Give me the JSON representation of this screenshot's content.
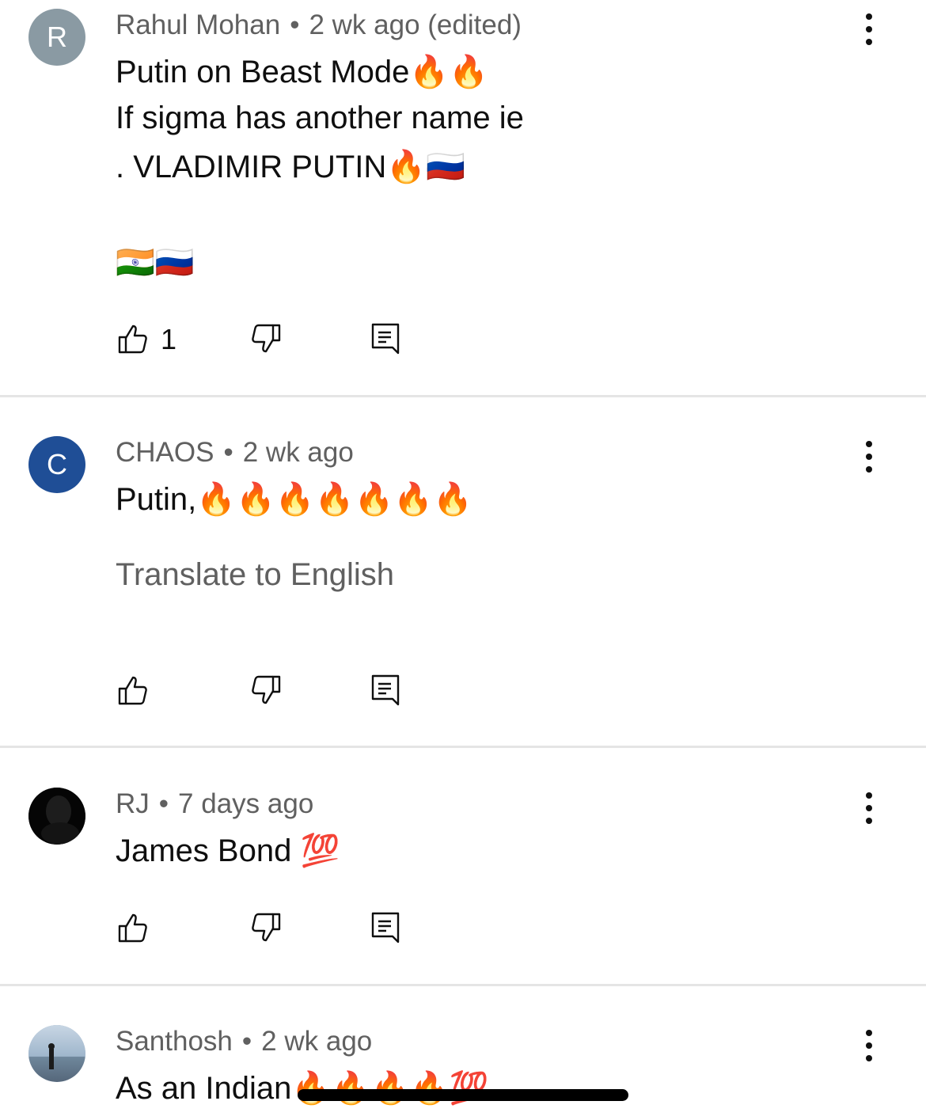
{
  "comments": [
    {
      "author": "Rahul Mohan",
      "time": "2 wk ago (edited)",
      "avatar_letter": "R",
      "avatar_color": "#8a9aa3",
      "lines": [
        "Putin on Beast Mode🔥🔥",
        "If sigma has another name ie",
        ". VLADIMIR PUTIN🔥🇷🇺",
        "🇮🇳🇷🇺"
      ],
      "likes": "1"
    },
    {
      "author": "CHAOS",
      "time": "2 wk ago",
      "avatar_letter": "C",
      "avatar_color": "#1f4e96",
      "lines": [
        "Putin,🔥🔥🔥🔥🔥🔥🔥"
      ],
      "translate": "Translate to English"
    },
    {
      "author": "RJ",
      "time": "7 days ago",
      "lines": [
        "James Bond 💯"
      ]
    },
    {
      "author": "Santhosh",
      "time": "2 wk ago",
      "lines": [
        "As an Indian🔥🔥🔥🔥💯"
      ]
    }
  ],
  "icons": {
    "like": "thumb-up-icon",
    "dislike": "thumb-down-icon",
    "reply": "reply-comment-icon",
    "menu": "more-vertical-icon"
  }
}
